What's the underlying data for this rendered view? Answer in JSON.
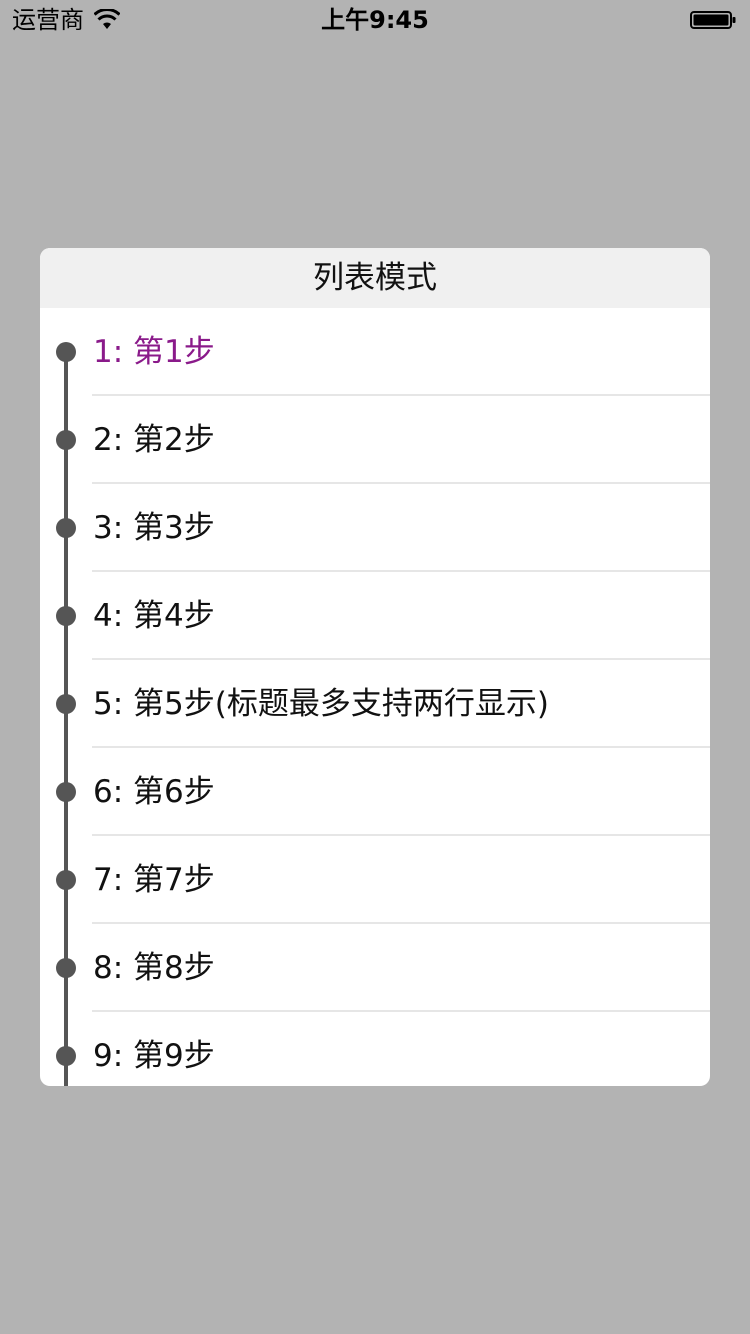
{
  "status_bar": {
    "carrier": "运营商",
    "time": "上午9:45"
  },
  "panel": {
    "title": "列表模式",
    "active_index": 0,
    "steps": [
      {
        "label": "1: 第1步"
      },
      {
        "label": "2: 第2步"
      },
      {
        "label": "3: 第3步"
      },
      {
        "label": "4: 第4步"
      },
      {
        "label": "5: 第5步(标题最多支持两行显示)"
      },
      {
        "label": "6: 第6步"
      },
      {
        "label": "7: 第7步"
      },
      {
        "label": "8: 第8步"
      },
      {
        "label": "9: 第9步"
      }
    ]
  },
  "colors": {
    "active_step": "#8a1a8a",
    "timeline": "#555555",
    "overlay": "#b3b3b3"
  }
}
